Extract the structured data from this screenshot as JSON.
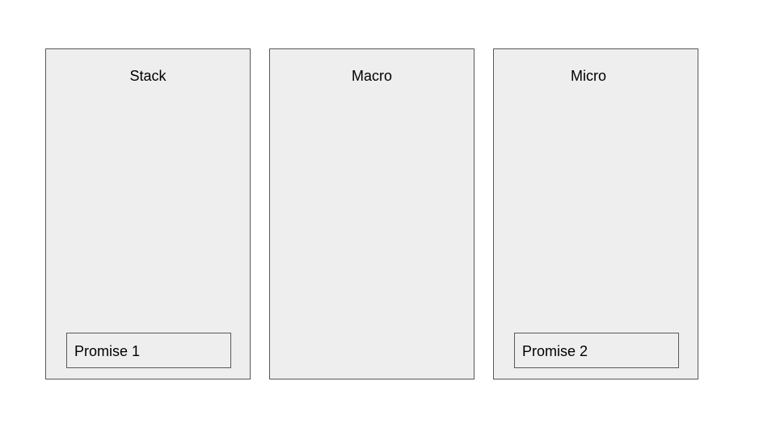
{
  "columns": [
    {
      "title": "Stack",
      "items": [
        "Promise 1"
      ]
    },
    {
      "title": "Macro",
      "items": []
    },
    {
      "title": "Micro",
      "items": [
        "Promise 2"
      ]
    }
  ],
  "colors": {
    "column_fill": "#eeeeee",
    "border": "#595959",
    "text": "#000000"
  }
}
